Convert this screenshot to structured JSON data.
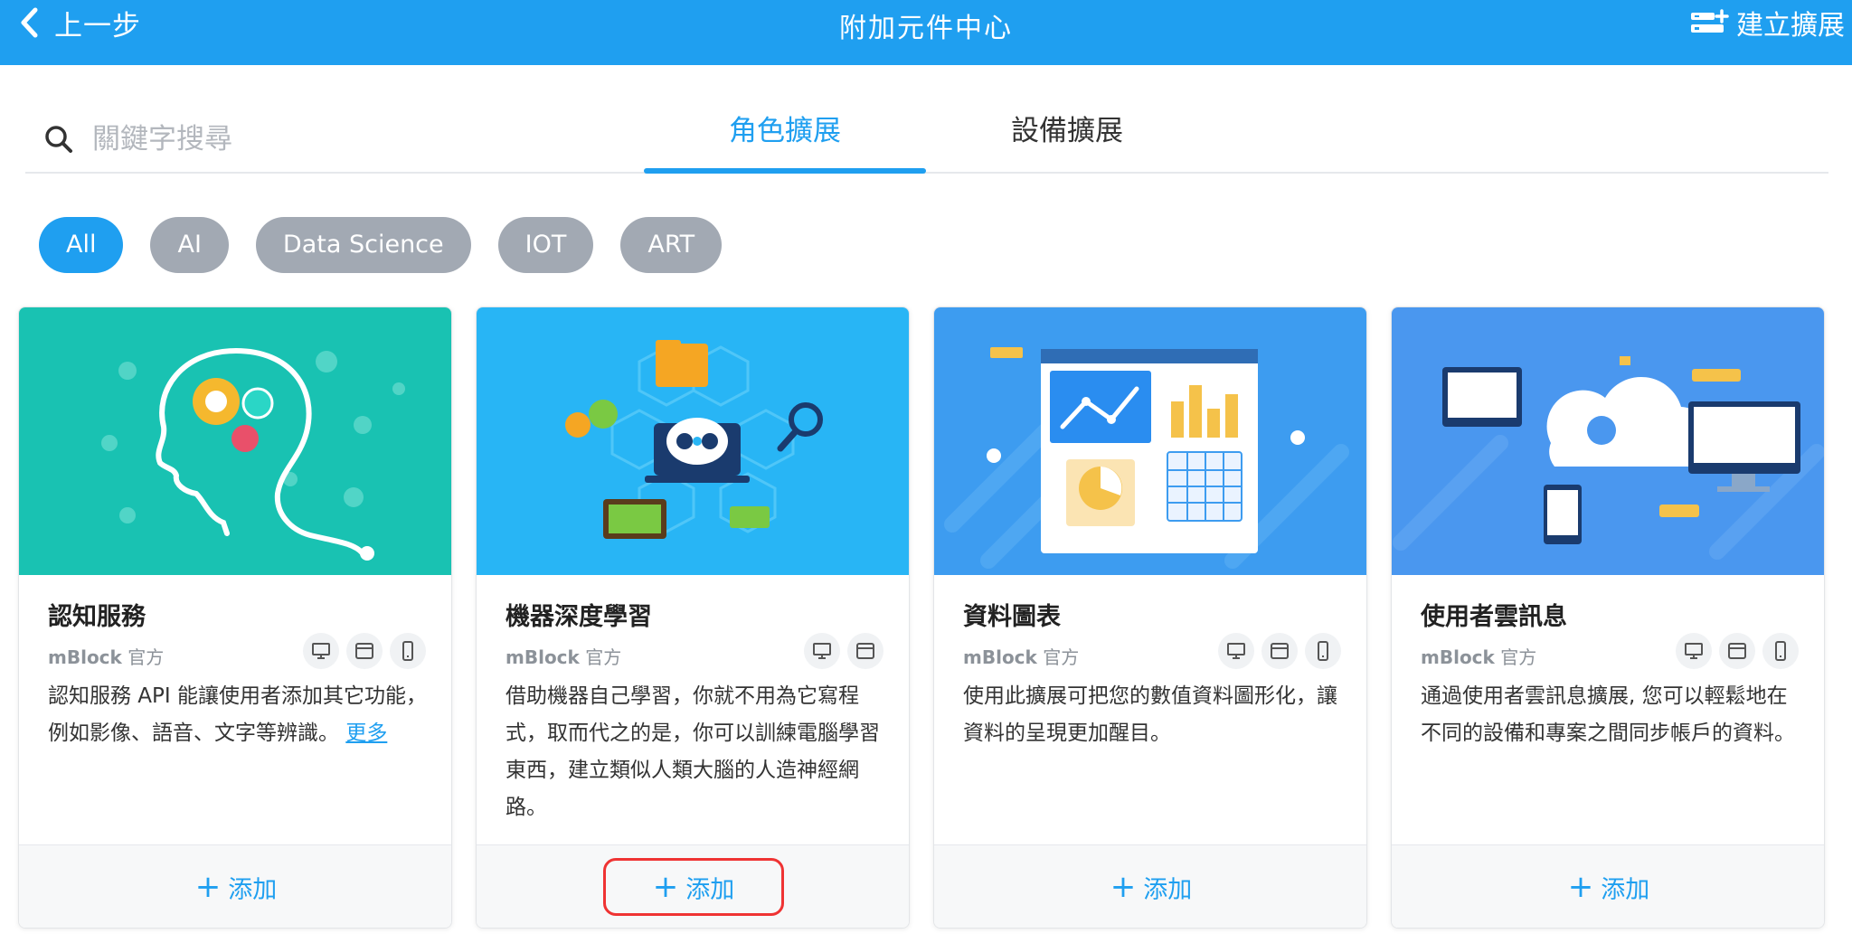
{
  "header": {
    "back_label": "上一步",
    "title": "附加元件中心",
    "create_label": "建立擴展"
  },
  "search": {
    "placeholder": "關鍵字搜尋"
  },
  "tabs": [
    {
      "label": "角色擴展",
      "active": true
    },
    {
      "label": "設備擴展",
      "active": false
    }
  ],
  "filters": [
    {
      "label": "All",
      "active": true
    },
    {
      "label": "AI"
    },
    {
      "label": "Data Science"
    },
    {
      "label": "IOT"
    },
    {
      "label": "ART"
    }
  ],
  "colors": {
    "accent": "#1f9ff0",
    "chip_inactive": "#a2a9b3",
    "highlight": "#ef3333"
  },
  "cards": [
    {
      "title": "認知服務",
      "author": "mBlock",
      "author_suffix": "官方",
      "desc": "認知服務 API 能讓使用者添加其它功能，例如影像、語音、文字等辨識。",
      "more": "更多",
      "devices": [
        "pc-icon",
        "browser-icon",
        "mobile-icon"
      ],
      "add_label": "添加",
      "banner_color": "#19c2b2"
    },
    {
      "title": "機器深度學習",
      "author": "mBlock",
      "author_suffix": "官方",
      "desc": "借助機器自己學習，你就不用為它寫程式，取而代之的是，你可以訓練電腦學習東西，建立類似人類大腦的人造神經網路。",
      "devices": [
        "pc-icon",
        "browser-icon"
      ],
      "add_label": "添加",
      "banner_color": "#28b5f5"
    },
    {
      "title": "資料圖表",
      "author": "mBlock",
      "author_suffix": "官方",
      "desc": "使用此擴展可把您的數值資料圖形化，讓資料的呈現更加醒目。",
      "devices": [
        "pc-icon",
        "browser-icon",
        "mobile-icon"
      ],
      "add_label": "添加",
      "banner_color": "#3d9cf0"
    },
    {
      "title": "使用者雲訊息",
      "author": "mBlock",
      "author_suffix": "官方",
      "desc": "通過使用者雲訊息擴展, 您可以輕鬆地在不同的設備和專案之間同步帳戶的資料。",
      "devices": [
        "pc-icon",
        "browser-icon",
        "mobile-icon"
      ],
      "add_label": "添加",
      "banner_color": "#4a97ef"
    }
  ]
}
